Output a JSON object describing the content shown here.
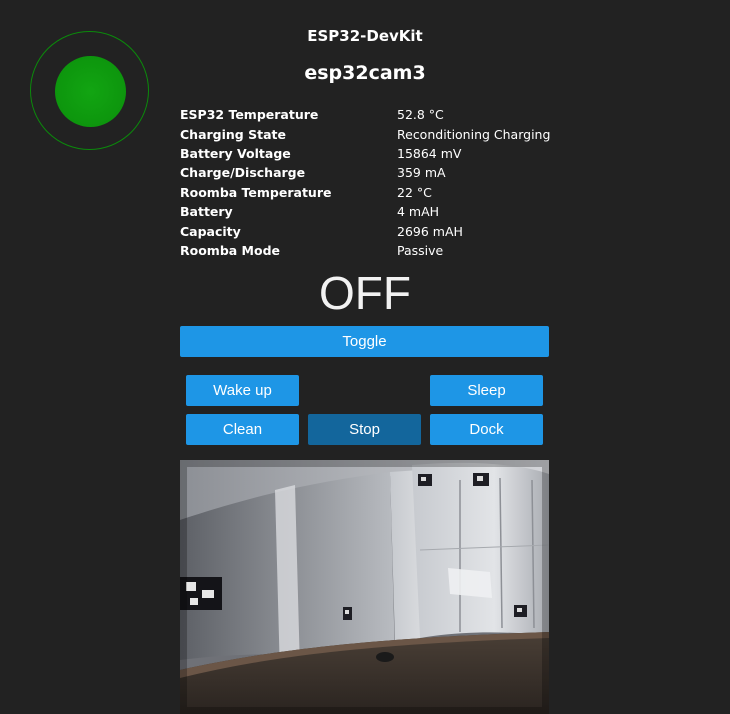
{
  "device": {
    "board": "ESP32-DevKit",
    "name": "esp32cam3",
    "status_color": "#0f9a0f"
  },
  "stats": [
    {
      "label": "ESP32 Temperature",
      "value": "52.8 °C"
    },
    {
      "label": "Charging State",
      "value": "Reconditioning Charging"
    },
    {
      "label": "Battery Voltage",
      "value": "15864 mV"
    },
    {
      "label": "Charge/Discharge",
      "value": "359 mA"
    },
    {
      "label": "Roomba Temperature",
      "value": "22 °C"
    },
    {
      "label": "Battery",
      "value": "4 mAH"
    },
    {
      "label": "Capacity",
      "value": "2696 mAH"
    },
    {
      "label": "Roomba Mode",
      "value": "Passive"
    }
  ],
  "power": {
    "state": "OFF"
  },
  "controls": {
    "toggle": "Toggle",
    "wake_up": "Wake up",
    "sleep": "Sleep",
    "clean": "Clean",
    "stop": "Stop",
    "dock": "Dock"
  },
  "colors": {
    "background": "#222222",
    "button": "#1e96e6",
    "button_active": "#13669c"
  }
}
